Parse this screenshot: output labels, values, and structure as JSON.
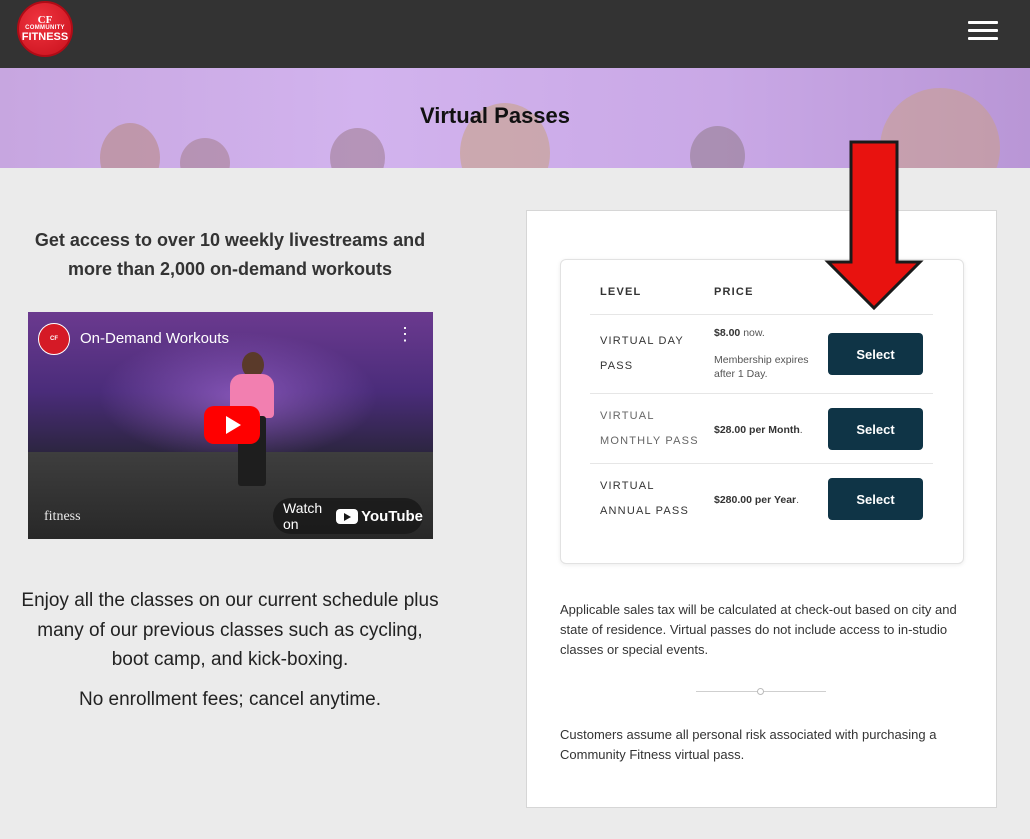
{
  "brand": {
    "logo_top": "CF",
    "logo_line1": "COMMUNITY",
    "logo_line2": "FITNESS"
  },
  "hero": {
    "title": "Virtual Passes"
  },
  "left": {
    "lead": "Get access to over 10 weekly livestreams and more than 2,000 on-demand workouts",
    "video": {
      "title": "On-Demand Workouts",
      "brand_text": "fitness",
      "watch_on": "Watch on",
      "youtube": "YouTube"
    },
    "enjoy": "Enjoy all the classes on our current schedule plus many of our previous classes such as cycling, boot camp, and kick-boxing.",
    "no_fees": "No enrollment fees; cancel anytime."
  },
  "table": {
    "col_level": "LEVEL",
    "col_price": "PRICE",
    "rows": [
      {
        "level_line1": "VIRTUAL DAY",
        "level_line2": "PASS",
        "price": "$8.00",
        "price_suffix": " now.",
        "note": "Membership expires after 1 Day.",
        "button": "Select"
      },
      {
        "level_line1": "VIRTUAL",
        "level_line2": "MONTHLY PASS",
        "price": "$28.00 per Month",
        "price_suffix": ".",
        "button": "Select"
      },
      {
        "level_line1": "VIRTUAL",
        "level_line2": "ANNUAL PASS",
        "price": "$280.00 per Year",
        "price_suffix": ".",
        "button": "Select"
      }
    ]
  },
  "notes": {
    "tax": "Applicable sales tax will be calculated at check-out based on city and state of residence. Virtual passes do not include access to in-studio classes or special events.",
    "risk": "Customers assume all personal risk associated with purchasing a Community Fitness virtual pass."
  },
  "colors": {
    "topbar": "#333333",
    "button": "#0f3446",
    "arrow": "#e8120f",
    "hero": "#d2b3ee"
  }
}
